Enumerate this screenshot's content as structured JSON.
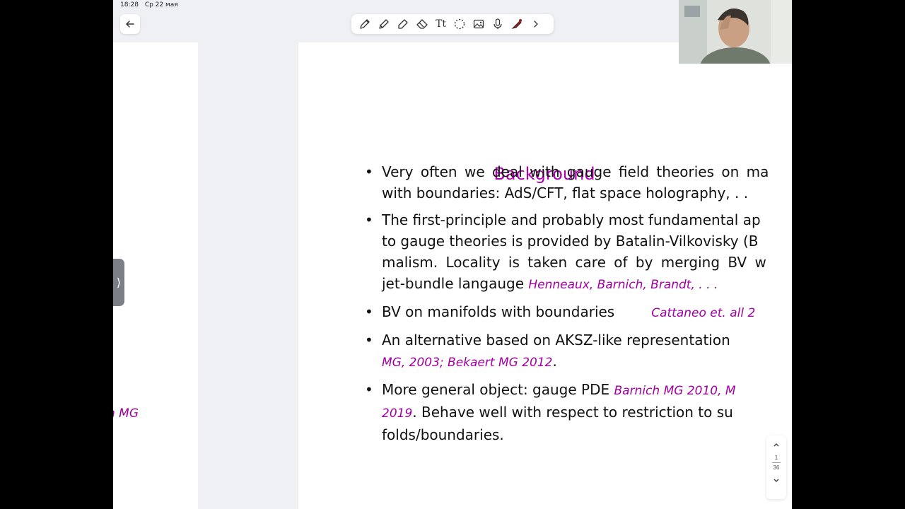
{
  "status_bar": {
    "time": "18:28",
    "date": "Ср 22 мая"
  },
  "toolbar": {
    "tools": [
      {
        "icon": "pen-icon"
      },
      {
        "icon": "pencil-icon"
      },
      {
        "icon": "highlighter-icon"
      },
      {
        "icon": "eraser-icon"
      },
      {
        "icon": "text-tool-icon"
      },
      {
        "icon": "lasso-icon"
      },
      {
        "icon": "image-icon"
      },
      {
        "icon": "microphone-icon"
      },
      {
        "icon": "laser-pointer-icon"
      },
      {
        "icon": "chevron-right-icon"
      }
    ],
    "text_tool_glyph": "Tt"
  },
  "left_page": {
    "fragment": "n MG"
  },
  "slide": {
    "title": "Background",
    "bullets": [
      {
        "lines": [
          "Very often we deal with gauge field theories on ma",
          "with boundaries: AdS/CFT, flat space holography, . ."
        ]
      },
      {
        "lines": [
          "The first-principle and probably most fundamental ap",
          "to gauge theories is provided by Batalin-Vilkovisky (B",
          "malism. Locality is taken care of by merging BV w"
        ],
        "last_line_text": "jet-bundle langauge",
        "last_line_ref": "Henneaux, Barnich, Brandt, . . ."
      },
      {
        "text": "BV on manifolds with boundaries",
        "ref": "Cattaneo et. all 2"
      },
      {
        "text": "An alternative based on AKSZ-like representation",
        "ref_line": "MG, 2003; Bekaert MG 2012",
        "ref_line_suffix": "."
      },
      {
        "text": "More general object: gauge PDE",
        "ref": "Barnich MG 2010, M",
        "line2_ref": "2019",
        "line2_text": ". Behave well with respect to restriction to su",
        "line3_text": "folds/boundaries."
      }
    ]
  },
  "pager": {
    "current": "1",
    "total": "36"
  },
  "colors": {
    "accent": "#a000a0",
    "laser": "#a01818"
  }
}
